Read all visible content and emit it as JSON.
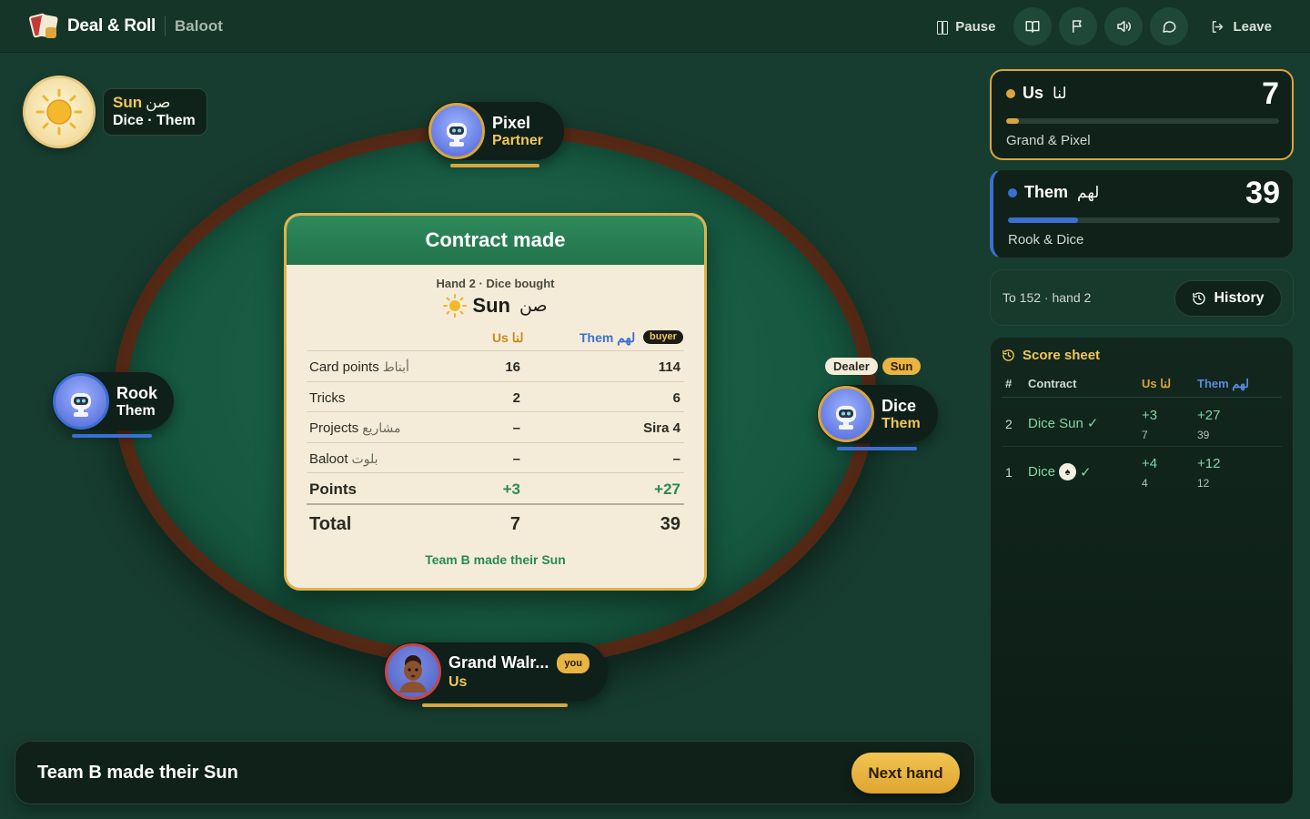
{
  "header": {
    "brand": "Deal & Roll",
    "game": "Baloot",
    "pause_label": "Pause",
    "icons": [
      "book-icon",
      "flag-icon",
      "sound-icon",
      "chat-icon"
    ],
    "leave_label": "Leave"
  },
  "contract_badge": {
    "contract": "Sun",
    "contract_ar": "صن",
    "line2": "Dice · Them"
  },
  "players": {
    "top": {
      "name": "Pixel",
      "team": "Partner"
    },
    "left": {
      "name": "Rook",
      "team": "Them"
    },
    "right": {
      "name": "Dice",
      "team": "Them",
      "dealer_tag": "Dealer",
      "contract_tag": "Sun"
    },
    "bottom": {
      "name": "Grand Walr...",
      "team": "Us",
      "you_tag": "you"
    }
  },
  "result": {
    "title": "Contract made",
    "subtitle": "Hand 2 · Dice bought",
    "contract": "Sun",
    "contract_ar": "صن",
    "col_us": "Us لنا",
    "col_them": "Them لهم",
    "buyer_tag": "buyer",
    "rows": [
      {
        "label": "Card points",
        "label_ar": "أبناط",
        "us": "16",
        "them": "114"
      },
      {
        "label": "Tricks",
        "label_ar": "",
        "us": "2",
        "them": "6"
      },
      {
        "label": "Projects",
        "label_ar": "مشاريع",
        "us": "–",
        "them": "Sira 4"
      },
      {
        "label": "Baloot",
        "label_ar": "بلوت",
        "us": "–",
        "them": "–"
      }
    ],
    "points": {
      "label": "Points",
      "us": "+3",
      "them": "+27"
    },
    "total": {
      "label": "Total",
      "us": "7",
      "them": "39"
    },
    "footer": "Team B made their Sun"
  },
  "banner": {
    "message": "Team B made their Sun",
    "next_label": "Next hand"
  },
  "scores": {
    "us": {
      "title": "Us",
      "title_ar": "لنا",
      "score": "7",
      "members": "Grand & Pixel",
      "progress": 0.046,
      "color": "#d9a53c"
    },
    "them": {
      "title": "Them",
      "title_ar": "لهم",
      "score": "39",
      "members": "Rook & Dice",
      "progress": 0.257,
      "color": "#3b6fd1"
    }
  },
  "target": {
    "text": "To 152 · hand 2",
    "history_label": "History"
  },
  "score_sheet": {
    "title": "Score sheet",
    "headers": {
      "num": "#",
      "contract": "Contract",
      "us": "Us لنا",
      "them": "Them لهم"
    },
    "rows": [
      {
        "num": "2",
        "contract": "Dice Sun",
        "check": "✓",
        "us_delta": "+3",
        "us_total": "7",
        "them_delta": "+27",
        "them_total": "39"
      },
      {
        "num": "1",
        "contract": "Dice",
        "check": "✓",
        "chip": "♠",
        "us_delta": "+4",
        "us_total": "4",
        "them_delta": "+12",
        "them_total": "12"
      }
    ]
  },
  "colors": {
    "felt": "#1e6b4f",
    "gold": "#f0c75a",
    "blue": "#3b6fd1",
    "green_text": "#2a8a4f"
  }
}
